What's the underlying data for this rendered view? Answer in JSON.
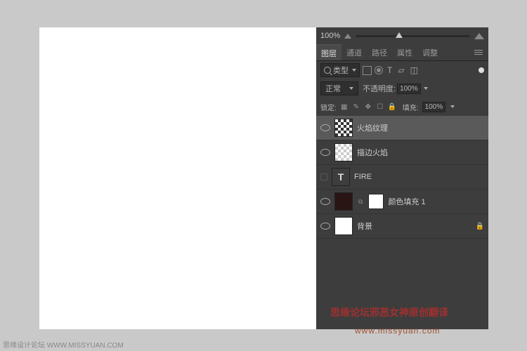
{
  "zoom": {
    "value": "100%"
  },
  "tabs": [
    "图层",
    "通道",
    "路径",
    "属性",
    "调整"
  ],
  "filter": {
    "label": "类型"
  },
  "blend": {
    "mode": "正常",
    "opacity_label": "不透明度:",
    "opacity": "100%"
  },
  "lock": {
    "label": "锁定:",
    "fill_label": "填充:",
    "fill": "100%"
  },
  "layers": [
    {
      "name": "火焰纹理",
      "visible": true,
      "selected": true,
      "thumb": "tex"
    },
    {
      "name": "描边火焰",
      "visible": true,
      "selected": false,
      "thumb": "checker"
    },
    {
      "name": "FIRE",
      "visible": false,
      "selected": false,
      "thumb": "txt"
    },
    {
      "name": "颜色填充 1",
      "visible": true,
      "selected": false,
      "thumb": "dark",
      "mask": true
    },
    {
      "name": "背景",
      "visible": true,
      "selected": false,
      "thumb": "white",
      "locked": true
    }
  ],
  "watermark": {
    "line1": "思缘论坛邪恶女神原创翻译",
    "line2": "www.missyuan.com"
  },
  "footer": {
    "text": "思缘设计论坛 WWW.MISSYUAN.COM"
  }
}
